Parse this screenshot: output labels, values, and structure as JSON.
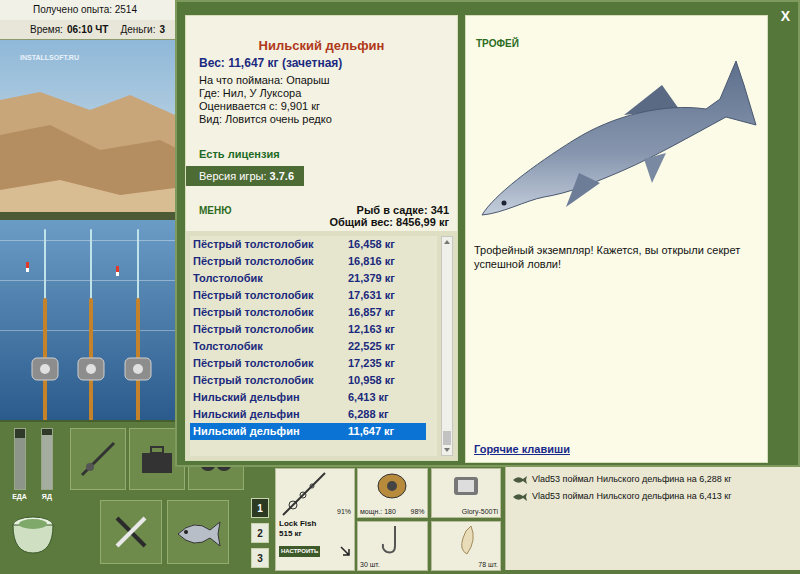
{
  "hud": {
    "experience": "Получено опыта: 2514",
    "time_label": "Время:",
    "time": "06:10 ЧТ",
    "money_label": "Деньги:",
    "money": "3"
  },
  "watermark": "INSTALLSOFT.RU",
  "dialog": {
    "close": "X",
    "fish": {
      "title": "Нильский дельфин",
      "weight": "Вес: 11,647 кг (зачетная)",
      "lines": [
        "На что поймана: Опарыш",
        "Где: Нил, У Луксора",
        "Оценивается с: 9,901 кг",
        "Вид: Ловится очень редко"
      ]
    },
    "license": "Есть лицензия",
    "version_label": "Версия игры:",
    "version": "3.7.6",
    "menu": "МЕНЮ",
    "keepnet_count": "Рыб в садке: 341",
    "total_weight": "Общий вес: 8456,99 кг",
    "catches": [
      {
        "name": "Пёстрый толстолобик",
        "weight": "16,458 кг",
        "selected": false
      },
      {
        "name": "Пёстрый толстолобик",
        "weight": "16,816 кг",
        "selected": false
      },
      {
        "name": "Толстолобик",
        "weight": "21,379 кг",
        "selected": false
      },
      {
        "name": "Пёстрый толстолобик",
        "weight": "17,631 кг",
        "selected": false
      },
      {
        "name": "Пёстрый толстолобик",
        "weight": "16,857 кг",
        "selected": false
      },
      {
        "name": "Пёстрый толстолобик",
        "weight": "12,163 кг",
        "selected": false
      },
      {
        "name": "Толстолобик",
        "weight": "22,525 кг",
        "selected": false
      },
      {
        "name": "Пёстрый толстолобик",
        "weight": "17,235 кг",
        "selected": false
      },
      {
        "name": "Пёстрый толстолобик",
        "weight": "10,958 кг",
        "selected": false
      },
      {
        "name": "Нильский дельфин",
        "weight": "6,413 кг",
        "selected": false
      },
      {
        "name": "Нильский дельфин",
        "weight": "6,288 кг",
        "selected": false
      },
      {
        "name": "Нильский дельфин",
        "weight": "11,647 кг",
        "selected": true
      }
    ],
    "catches_scroll": {
      "level": 1
    },
    "trophy": {
      "label": "ТРОФЕЙ",
      "text": "Трофейный экземпляр! Кажется, вы открыли секрет успешной ловли!",
      "hotkeys": "Горячие клавиши"
    }
  },
  "controls": {
    "meters": [
      {
        "label": "ЕДА",
        "level": 0.85
      },
      {
        "label": "ЯД",
        "level": 0.9
      }
    ],
    "rod_sets": [
      {
        "label": "1",
        "selected": true
      },
      {
        "label": "2",
        "selected": false
      },
      {
        "label": "3",
        "selected": false
      }
    ],
    "rod": {
      "name": "Lock Fish",
      "capacity": "515 кг",
      "condition": "91%",
      "button": "НАСТРОИТЬ"
    },
    "reel": {
      "power": "мощн.: 180",
      "condition": "98%"
    },
    "line": {
      "name": "Glory-500Ti"
    },
    "hook": {
      "count": "30 шт."
    },
    "bait": {
      "count": "78 шт."
    }
  },
  "log": [
    "Vlad53 поймал Нильского дельфина на 6,288 кг",
    "Vlad53 поймал Нильского дельфина на 6,413 кг"
  ]
}
